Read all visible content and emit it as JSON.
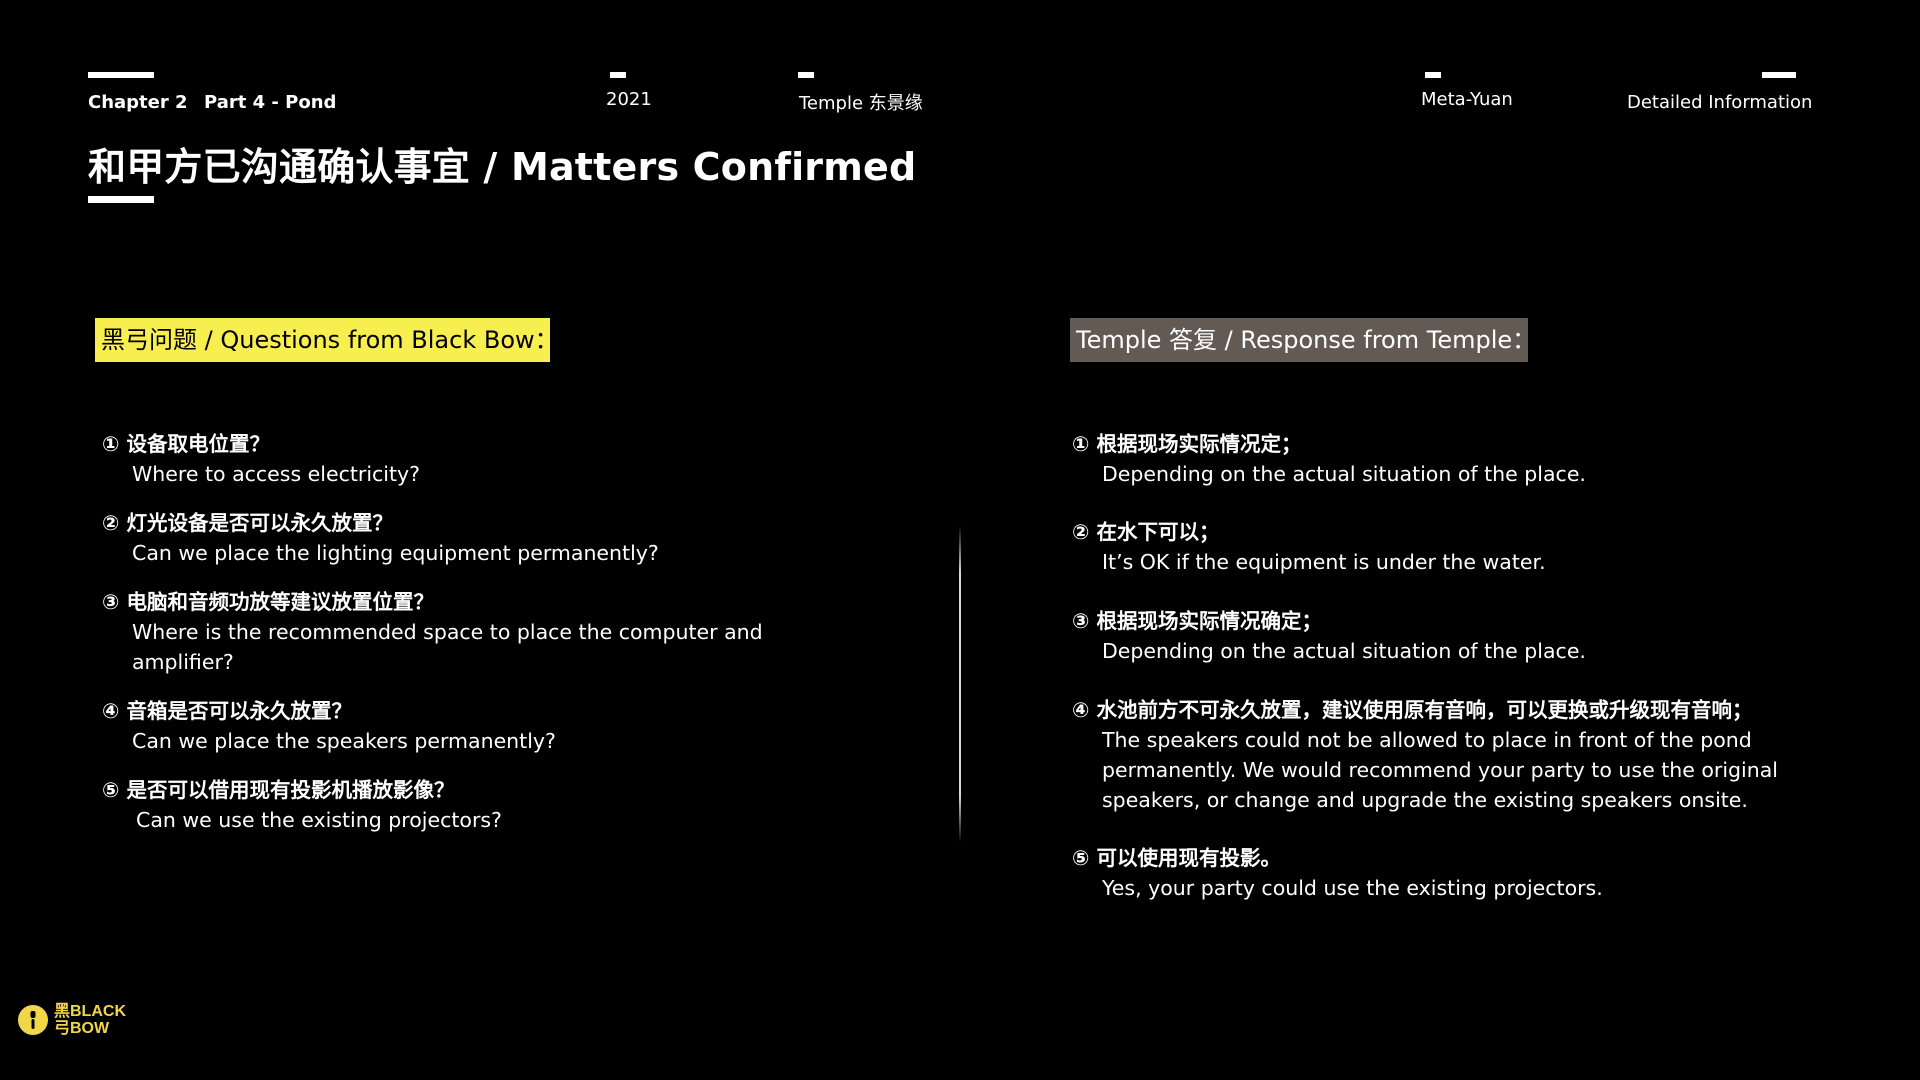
{
  "header": {
    "chapter": "Chapter 2",
    "part": "Part 4 - Pond",
    "year": "2021",
    "temple": "Temple 东景缘",
    "meta": "Meta-Yuan",
    "detail": "Detailed Information"
  },
  "page": {
    "title": "和甲方已沟通确认事宜 / Matters Confirmed"
  },
  "questions": {
    "heading": "黑弓问题 / Questions from Black Bow：",
    "items": [
      {
        "zh": "① 设备取电位置？",
        "en": "Where to access electricity?"
      },
      {
        "zh": "② 灯光设备是否可以永久放置？",
        "en": "Can we place the lighting equipment permanently?"
      },
      {
        "zh": "③ 电脑和音频功放等建议放置位置？",
        "en": "Where is the recommended space to place the computer and amplifier?"
      },
      {
        "zh": "④ 音箱是否可以永久放置？",
        "en": "Can we place the speakers permanently?"
      },
      {
        "zh": "⑤ 是否可以借用现有投影机播放影像？",
        "en": "Can we use the existing projectors?"
      }
    ]
  },
  "responses": {
    "heading": "Temple 答复 / Response from Temple：",
    "items": [
      {
        "zh": "① 根据现场实际情况定；",
        "en": "Depending on the actual situation of the place."
      },
      {
        "zh": "② 在水下可以；",
        "en": "It’s OK if the equipment is under the water."
      },
      {
        "zh": "③ 根据现场实际情况确定；",
        "en": "Depending on the actual situation of the place."
      },
      {
        "zh": "④ 水池前方不可永久放置，建议使用原有音响，可以更换或升级现有音响；",
        "en": "The speakers could not be allowed to place in front of the pond permanently. We would recommend your party to use the original speakers, or change and upgrade the existing speakers onsite."
      },
      {
        "zh": "⑤ 可以使用现有投影。",
        "en": "Yes, your party could use the existing projectors."
      }
    ]
  },
  "logo": {
    "line1": "黑BLACK",
    "line2": "弓BOW"
  },
  "colors": {
    "background": "#000000",
    "question_heading_bg": "#f7ee50",
    "response_heading_bg": "#635a53",
    "logo": "#f2d64a"
  }
}
